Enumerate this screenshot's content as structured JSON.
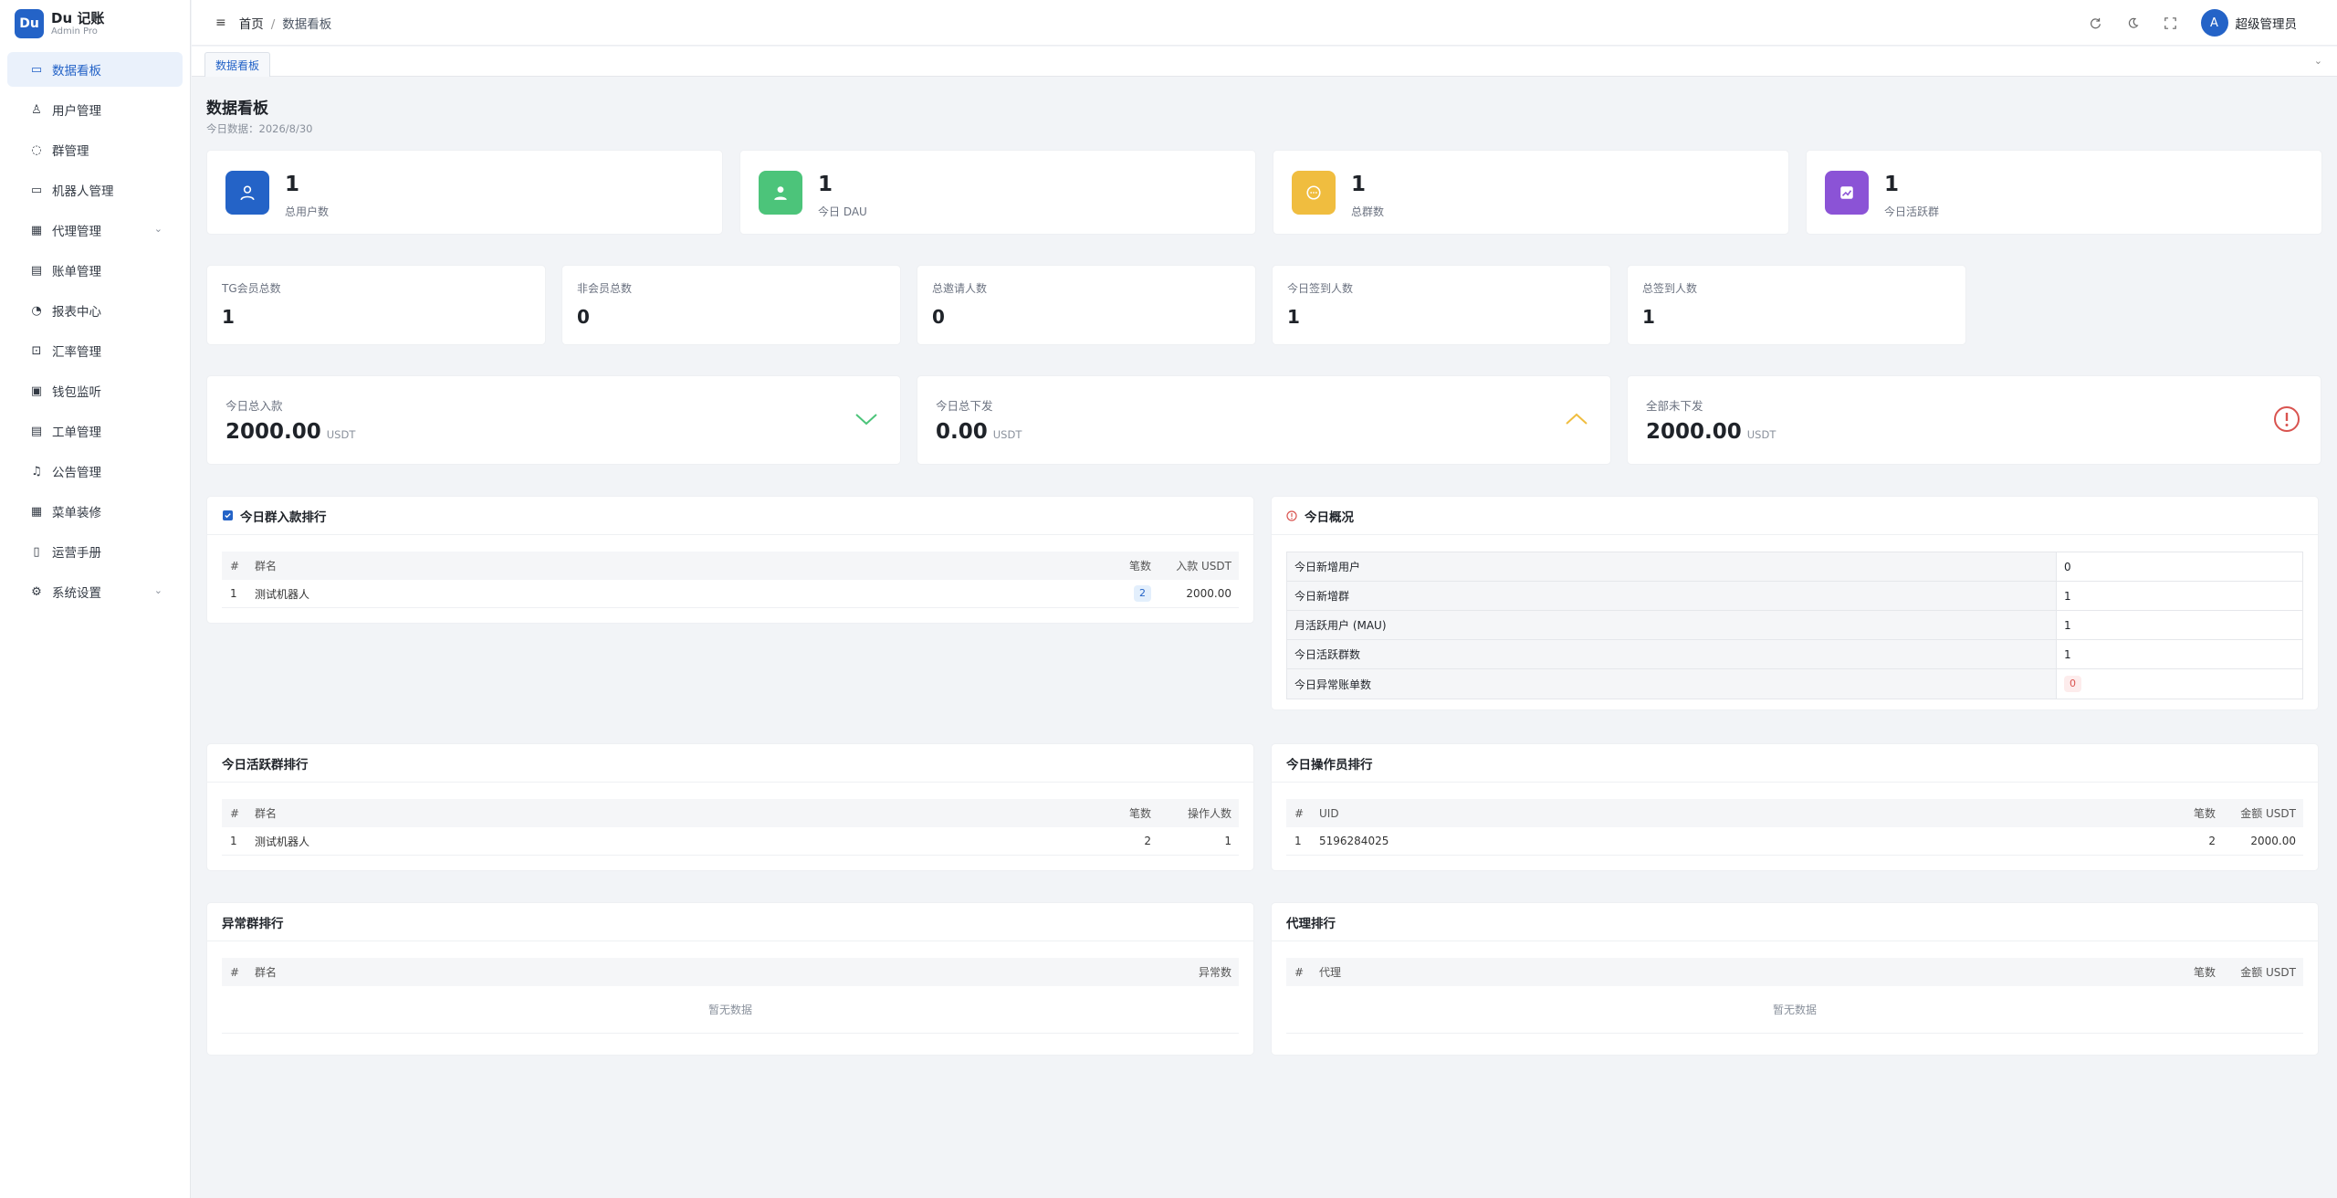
{
  "app": {
    "logo_letter": "Du",
    "title": "Du 记账",
    "subtitle": "Admin Pro"
  },
  "sidebar": {
    "items": [
      {
        "label": "数据看板",
        "icon": "dashboard-icon",
        "glyph": "▭",
        "active": true
      },
      {
        "label": "用户管理",
        "icon": "user-icon",
        "glyph": "♙"
      },
      {
        "label": "群管理",
        "icon": "chat-icon",
        "glyph": "◌"
      },
      {
        "label": "机器人管理",
        "icon": "monitor-icon",
        "glyph": "▭"
      },
      {
        "label": "代理管理",
        "icon": "building-icon",
        "glyph": "▦",
        "expandable": true
      },
      {
        "label": "账单管理",
        "icon": "document-icon",
        "glyph": "▤"
      },
      {
        "label": "报表中心",
        "icon": "pie-chart-icon",
        "glyph": "◔"
      },
      {
        "label": "汇率管理",
        "icon": "exchange-icon",
        "glyph": "⊡"
      },
      {
        "label": "钱包监听",
        "icon": "wallet-icon",
        "glyph": "▣"
      },
      {
        "label": "工单管理",
        "icon": "ticket-icon",
        "glyph": "▤"
      },
      {
        "label": "公告管理",
        "icon": "bell-icon",
        "glyph": "♫"
      },
      {
        "label": "菜单装修",
        "icon": "grid-icon",
        "glyph": "▦"
      },
      {
        "label": "运营手册",
        "icon": "book-icon",
        "glyph": "▯"
      },
      {
        "label": "系统设置",
        "icon": "gear-icon",
        "glyph": "⚙",
        "expandable": true
      }
    ]
  },
  "header": {
    "home": "首页",
    "current": "数据看板",
    "avatar_letter": "A",
    "username": "超级管理员"
  },
  "tabs": [
    {
      "label": "数据看板"
    }
  ],
  "page": {
    "title": "数据看板",
    "subtitle": "今日数据：2026/8/30"
  },
  "stats": [
    {
      "value": "1",
      "label": "总用户数",
      "color": "#2463c7",
      "icon": "user-icon"
    },
    {
      "value": "1",
      "label": "今日 DAU",
      "color": "#4cc47a",
      "icon": "person-icon"
    },
    {
      "value": "1",
      "label": "总群数",
      "color": "#f0bd3f",
      "icon": "chat-icon"
    },
    {
      "value": "1",
      "label": "今日活跃群",
      "color": "#8b53d6",
      "icon": "trend-icon"
    }
  ],
  "mini_stats": [
    {
      "label": "TG会员总数",
      "value": "1"
    },
    {
      "label": "非会员总数",
      "value": "0"
    },
    {
      "label": "总邀请人数",
      "value": "0"
    },
    {
      "label": "今日签到人数",
      "value": "1"
    },
    {
      "label": "总签到人数",
      "value": "1"
    }
  ],
  "flow_stats": [
    {
      "label": "今日总入款",
      "value": "2000.00",
      "unit": "USDT",
      "icon": "chevron-down-icon",
      "color": "#4cc47a"
    },
    {
      "label": "今日总下发",
      "value": "0.00",
      "unit": "USDT",
      "icon": "chevron-up-icon",
      "color": "#f0bd3f"
    },
    {
      "label": "全部未下发",
      "value": "2000.00",
      "unit": "USDT",
      "icon": "alert-icon",
      "color": "#d9534f"
    }
  ],
  "panels": {
    "deposit_rank": {
      "title": "今日群入款排行",
      "headers": [
        "#",
        "群名",
        "笔数",
        "入款 USDT"
      ],
      "rows": [
        {
          "idx": "1",
          "name": "测试机器人",
          "count": "2",
          "amount": "2000.00"
        }
      ]
    },
    "overview": {
      "title": "今日概况",
      "rows": [
        {
          "k": "今日新增用户",
          "v": "0"
        },
        {
          "k": "今日新增群",
          "v": "1"
        },
        {
          "k": "月活跃用户 (MAU)",
          "v": "1"
        },
        {
          "k": "今日活跃群数",
          "v": "1"
        },
        {
          "k": "今日异常账单数",
          "v": "0",
          "badge": true
        }
      ]
    },
    "active_rank": {
      "title": "今日活跃群排行",
      "headers": [
        "#",
        "群名",
        "笔数",
        "操作人数"
      ],
      "rows": [
        {
          "idx": "1",
          "name": "测试机器人",
          "count": "2",
          "ops": "1"
        }
      ]
    },
    "operator_rank": {
      "title": "今日操作员排行",
      "headers": [
        "#",
        "UID",
        "笔数",
        "金额 USDT"
      ],
      "rows": [
        {
          "idx": "1",
          "uid": "5196284025",
          "count": "2",
          "amount": "2000.00"
        }
      ]
    },
    "abnormal_rank": {
      "title": "异常群排行",
      "headers": [
        "#",
        "群名",
        "异常数"
      ],
      "empty": "暂无数据"
    },
    "agent_rank": {
      "title": "代理排行",
      "headers": [
        "#",
        "代理",
        "笔数",
        "金额 USDT"
      ],
      "empty": "暂无数据"
    }
  }
}
